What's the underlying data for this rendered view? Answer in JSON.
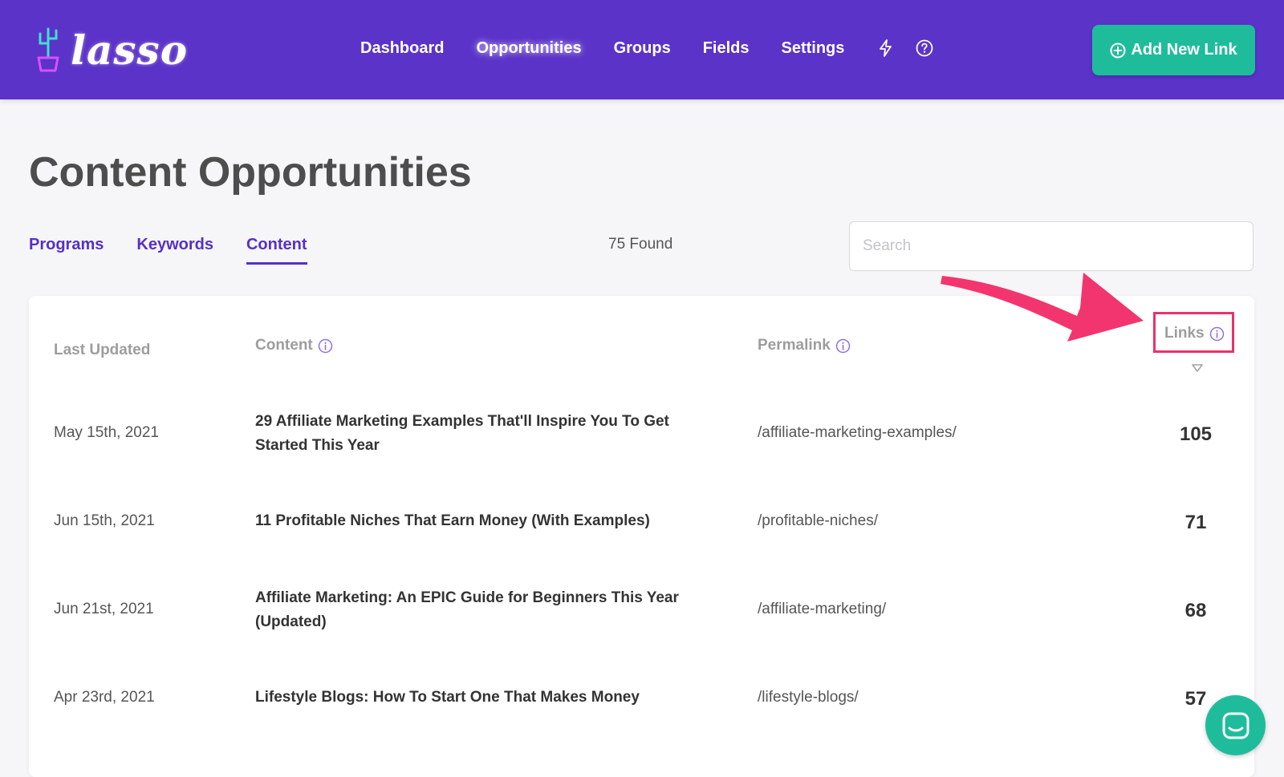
{
  "app": {
    "logo_text": "lasso"
  },
  "nav": {
    "items": [
      {
        "label": "Dashboard"
      },
      {
        "label": "Opportunities"
      },
      {
        "label": "Groups"
      },
      {
        "label": "Fields"
      },
      {
        "label": "Settings"
      }
    ],
    "icons": [
      "lightning-icon",
      "help-icon"
    ],
    "add_button": "Add New Link"
  },
  "page": {
    "title": "Content Opportunities"
  },
  "tabs": [
    {
      "label": "Programs"
    },
    {
      "label": "Keywords"
    },
    {
      "label": "Content",
      "active": true
    }
  ],
  "found_text": "75 Found",
  "search": {
    "placeholder": "Search",
    "value": ""
  },
  "table": {
    "headers": {
      "last_updated": "Last Updated",
      "content": "Content",
      "permalink": "Permalink",
      "links": "Links"
    },
    "sort": {
      "column": "links",
      "direction": "descending"
    },
    "rows": [
      {
        "date": "May 15th, 2021",
        "title": "29 Affiliate Marketing Examples That'll Inspire You To Get Started This Year",
        "permalink": "/affiliate-marketing-examples/",
        "links": "105"
      },
      {
        "date": "Jun 15th, 2021",
        "title": "11 Profitable Niches That Earn Money (With Examples)",
        "permalink": "/profitable-niches/",
        "links": "71"
      },
      {
        "date": "Jun 21st, 2021",
        "title": "Affiliate Marketing: An EPIC Guide for Beginners This Year (Updated)",
        "permalink": "/affiliate-marketing/",
        "links": "68"
      },
      {
        "date": "Apr 23rd, 2021",
        "title": "Lifestyle Blogs: How To Start One That Makes Money",
        "permalink": "/lifestyle-blogs/",
        "links": "57"
      }
    ]
  },
  "colors": {
    "header_bg": "#5b33c9",
    "accent": "#5631c4",
    "button_green": "#1fbc9c",
    "highlight": "#e8336d"
  }
}
